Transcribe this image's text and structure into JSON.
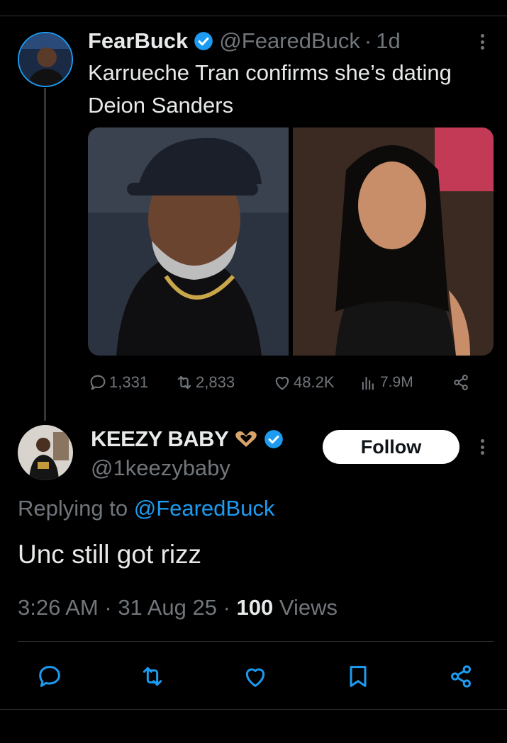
{
  "tweet": {
    "author": {
      "display_name": "FearBuck",
      "handle": "@FearedBuck",
      "time": "1d",
      "avatar_icon": "person-avatar-icon"
    },
    "text": "Karrueche Tran confirms she’s dating Deion Sanders",
    "images": [
      "photo-icon",
      "photo-icon"
    ],
    "stats": {
      "replies": "1,331",
      "reposts": "2,833",
      "likes": "48.2K",
      "views": "7.9M"
    }
  },
  "reply": {
    "author": {
      "display_name": "KEEZY BABY",
      "handle": "@1keezybaby",
      "emoji_icon": "heart-hands-icon"
    },
    "follow_label": "Follow",
    "replying_label": "Replying to",
    "replying_to": "@FearedBuck",
    "text": "Unc still got rizz",
    "time": "3:26 AM",
    "date": "31 Aug 25",
    "views_count": "100",
    "views_label": "Views"
  },
  "colors": {
    "accent": "#1d9bf0",
    "muted": "#71767b",
    "text": "#e7e9ea",
    "background": "#000000"
  }
}
